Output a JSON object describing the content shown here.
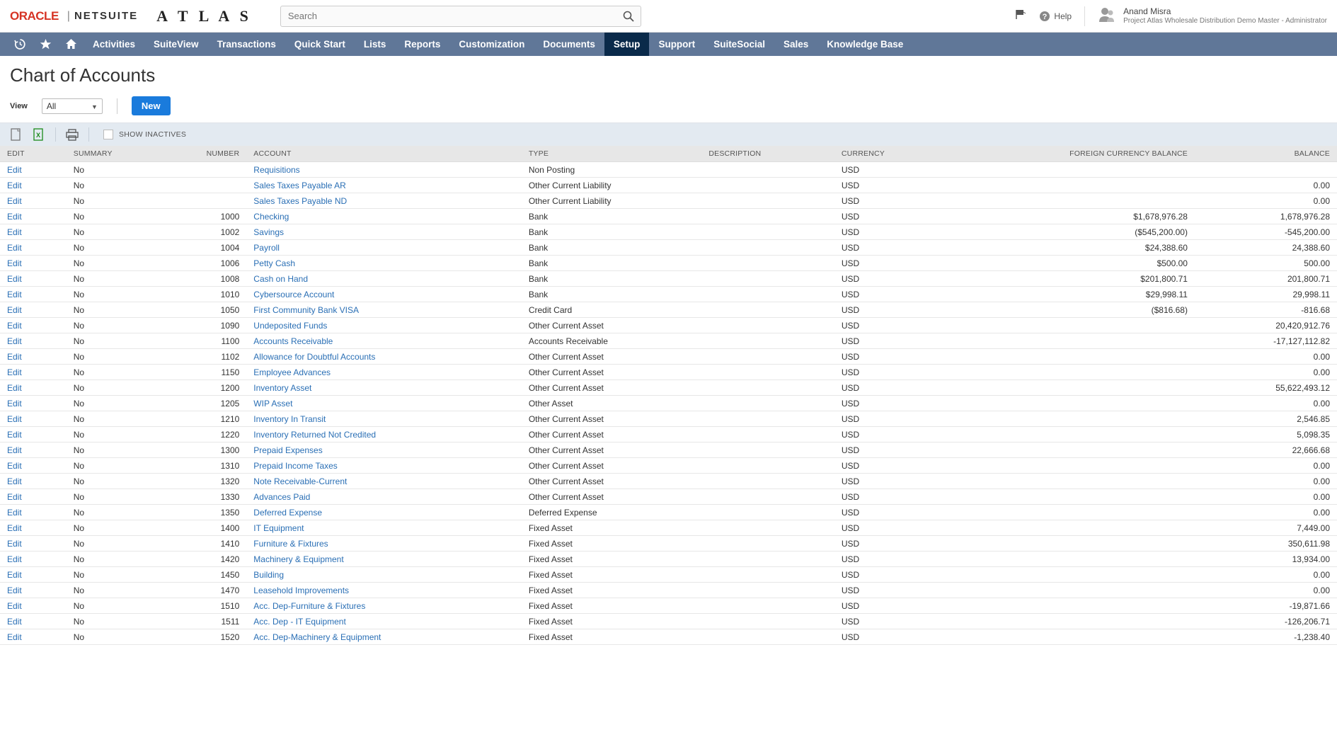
{
  "header": {
    "logo_oracle": "ORACLE",
    "logo_netsuite": "NETSUITE",
    "logo_atlas": "A T L A S",
    "search_placeholder": "Search",
    "help_label": "Help",
    "user_name": "Anand Misra",
    "user_role": "Project Atlas Wholesale Distribution Demo Master - Administrator"
  },
  "nav": {
    "items": [
      "Activities",
      "SuiteView",
      "Transactions",
      "Quick Start",
      "Lists",
      "Reports",
      "Customization",
      "Documents",
      "Setup",
      "Support",
      "SuiteSocial",
      "Sales",
      "Knowledge Base"
    ],
    "active_index": 8
  },
  "page": {
    "title": "Chart of Accounts",
    "view_label": "View",
    "view_value": "All",
    "new_button": "New",
    "show_inactives": "SHOW INACTIVES"
  },
  "table": {
    "headers": {
      "edit": "EDIT",
      "summary": "SUMMARY",
      "number": "NUMBER",
      "account": "ACCOUNT",
      "type": "TYPE",
      "description": "DESCRIPTION",
      "currency": "CURRENCY",
      "fcb": "FOREIGN CURRENCY BALANCE",
      "balance": "BALANCE"
    },
    "edit_label": "Edit",
    "summary_no": "No",
    "rows": [
      {
        "number": "",
        "account": "Requisitions",
        "type": "Non Posting",
        "currency": "USD",
        "fcb": "",
        "balance": ""
      },
      {
        "number": "",
        "account": "Sales Taxes Payable AR",
        "type": "Other Current Liability",
        "currency": "USD",
        "fcb": "",
        "balance": "0.00"
      },
      {
        "number": "",
        "account": "Sales Taxes Payable ND",
        "type": "Other Current Liability",
        "currency": "USD",
        "fcb": "",
        "balance": "0.00"
      },
      {
        "number": "1000",
        "account": "Checking",
        "type": "Bank",
        "currency": "USD",
        "fcb": "$1,678,976.28",
        "balance": "1,678,976.28"
      },
      {
        "number": "1002",
        "account": "Savings",
        "type": "Bank",
        "currency": "USD",
        "fcb": "($545,200.00)",
        "balance": "-545,200.00"
      },
      {
        "number": "1004",
        "account": "Payroll",
        "type": "Bank",
        "currency": "USD",
        "fcb": "$24,388.60",
        "balance": "24,388.60"
      },
      {
        "number": "1006",
        "account": "Petty Cash",
        "type": "Bank",
        "currency": "USD",
        "fcb": "$500.00",
        "balance": "500.00"
      },
      {
        "number": "1008",
        "account": "Cash on Hand",
        "type": "Bank",
        "currency": "USD",
        "fcb": "$201,800.71",
        "balance": "201,800.71"
      },
      {
        "number": "1010",
        "account": "Cybersource Account",
        "type": "Bank",
        "currency": "USD",
        "fcb": "$29,998.11",
        "balance": "29,998.11"
      },
      {
        "number": "1050",
        "account": "First Community Bank VISA",
        "type": "Credit Card",
        "currency": "USD",
        "fcb": "($816.68)",
        "balance": "-816.68"
      },
      {
        "number": "1090",
        "account": "Undeposited Funds",
        "type": "Other Current Asset",
        "currency": "USD",
        "fcb": "",
        "balance": "20,420,912.76"
      },
      {
        "number": "1100",
        "account": "Accounts Receivable",
        "type": "Accounts Receivable",
        "currency": "USD",
        "fcb": "",
        "balance": "-17,127,112.82"
      },
      {
        "number": "1102",
        "account": "Allowance for Doubtful Accounts",
        "type": "Other Current Asset",
        "currency": "USD",
        "fcb": "",
        "balance": "0.00"
      },
      {
        "number": "1150",
        "account": "Employee Advances",
        "type": "Other Current Asset",
        "currency": "USD",
        "fcb": "",
        "balance": "0.00"
      },
      {
        "number": "1200",
        "account": "Inventory Asset",
        "type": "Other Current Asset",
        "currency": "USD",
        "fcb": "",
        "balance": "55,622,493.12"
      },
      {
        "number": "1205",
        "account": "WIP Asset",
        "type": "Other Asset",
        "currency": "USD",
        "fcb": "",
        "balance": "0.00"
      },
      {
        "number": "1210",
        "account": "Inventory In Transit",
        "type": "Other Current Asset",
        "currency": "USD",
        "fcb": "",
        "balance": "2,546.85"
      },
      {
        "number": "1220",
        "account": "Inventory Returned Not Credited",
        "type": "Other Current Asset",
        "currency": "USD",
        "fcb": "",
        "balance": "5,098.35"
      },
      {
        "number": "1300",
        "account": "Prepaid Expenses",
        "type": "Other Current Asset",
        "currency": "USD",
        "fcb": "",
        "balance": "22,666.68"
      },
      {
        "number": "1310",
        "account": "Prepaid Income Taxes",
        "type": "Other Current Asset",
        "currency": "USD",
        "fcb": "",
        "balance": "0.00"
      },
      {
        "number": "1320",
        "account": "Note Receivable-Current",
        "type": "Other Current Asset",
        "currency": "USD",
        "fcb": "",
        "balance": "0.00"
      },
      {
        "number": "1330",
        "account": "Advances Paid",
        "type": "Other Current Asset",
        "currency": "USD",
        "fcb": "",
        "balance": "0.00"
      },
      {
        "number": "1350",
        "account": "Deferred Expense",
        "type": "Deferred Expense",
        "currency": "USD",
        "fcb": "",
        "balance": "0.00"
      },
      {
        "number": "1400",
        "account": "IT Equipment",
        "type": "Fixed Asset",
        "currency": "USD",
        "fcb": "",
        "balance": "7,449.00"
      },
      {
        "number": "1410",
        "account": "Furniture & Fixtures",
        "type": "Fixed Asset",
        "currency": "USD",
        "fcb": "",
        "balance": "350,611.98"
      },
      {
        "number": "1420",
        "account": "Machinery & Equipment",
        "type": "Fixed Asset",
        "currency": "USD",
        "fcb": "",
        "balance": "13,934.00"
      },
      {
        "number": "1450",
        "account": "Building",
        "type": "Fixed Asset",
        "currency": "USD",
        "fcb": "",
        "balance": "0.00"
      },
      {
        "number": "1470",
        "account": "Leasehold Improvements",
        "type": "Fixed Asset",
        "currency": "USD",
        "fcb": "",
        "balance": "0.00"
      },
      {
        "number": "1510",
        "account": "Acc. Dep-Furniture & Fixtures",
        "type": "Fixed Asset",
        "currency": "USD",
        "fcb": "",
        "balance": "-19,871.66"
      },
      {
        "number": "1511",
        "account": "Acc. Dep - IT Equipment",
        "type": "Fixed Asset",
        "currency": "USD",
        "fcb": "",
        "balance": "-126,206.71"
      },
      {
        "number": "1520",
        "account": "Acc. Dep-Machinery & Equipment",
        "type": "Fixed Asset",
        "currency": "USD",
        "fcb": "",
        "balance": "-1,238.40"
      }
    ]
  }
}
